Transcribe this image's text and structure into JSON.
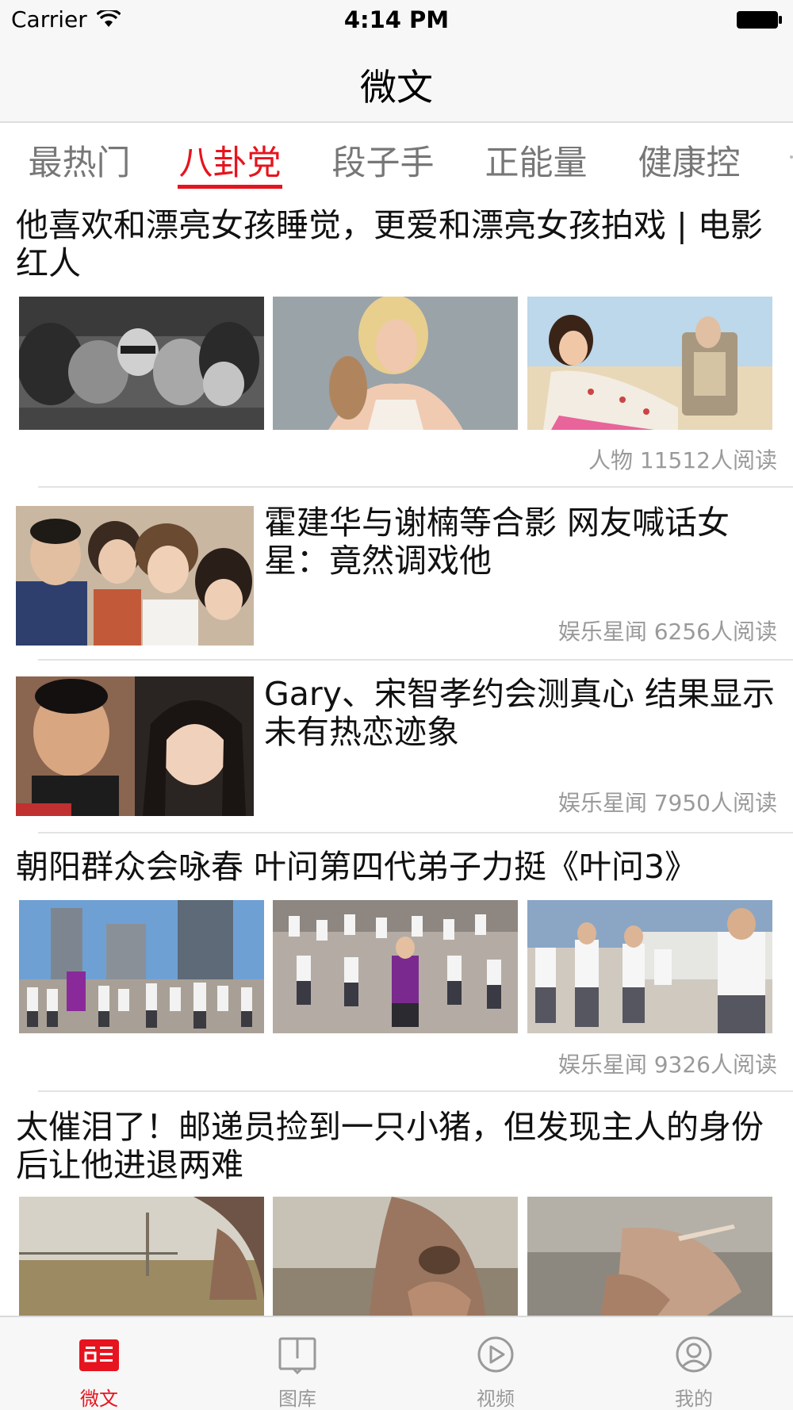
{
  "status_bar": {
    "carrier": "Carrier",
    "time": "4:14 PM"
  },
  "nav": {
    "title": "微文"
  },
  "tabs": [
    {
      "label": "最热门"
    },
    {
      "label": "八卦党"
    },
    {
      "label": "段子手"
    },
    {
      "label": "正能量"
    },
    {
      "label": "健康控"
    }
  ],
  "active_tab": "八卦党",
  "articles": [
    {
      "title_line1": "他喜欢和漂亮女孩睡觉，更爱和漂亮女孩拍戏 | 电影",
      "title_line2": "红人",
      "meta": "人物 11512人阅读",
      "images": [
        "photo-bw-group",
        "photo-blonde-portrait",
        "photo-beach-couple"
      ]
    },
    {
      "title_line1": "霍建华与谢楠等合影 网友喊话女",
      "title_line2": "星：竟然调戏他",
      "meta": "娱乐星闻 6256人阅读",
      "images": [
        "photo-group-selfie"
      ]
    },
    {
      "title_line1": "Gary、宋智孝约会测真心 结果显示",
      "title_line2": "未有热恋迹象",
      "meta": "娱乐星闻 7950人阅读",
      "images": [
        "photo-tv-show"
      ]
    },
    {
      "title_line1": "朝阳群众会咏春 叶问第四代弟子力挺《叶问3》",
      "meta": "娱乐星闻 9326人阅读",
      "images": [
        "photo-crowd-street",
        "photo-crowd-square",
        "photo-crowd-kungfu"
      ]
    },
    {
      "title_line1": "太催泪了！邮递员捡到一只小猪，但发现主人的身份",
      "title_line2": "后让他进退两难",
      "images": [
        "photo-field",
        "photo-man-face",
        "photo-hand-closeup"
      ]
    }
  ],
  "tab_bar": [
    {
      "label": "微文",
      "icon": "news-icon"
    },
    {
      "label": "图库",
      "icon": "book-icon"
    },
    {
      "label": "视频",
      "icon": "play-icon"
    },
    {
      "label": "我的",
      "icon": "profile-icon"
    }
  ],
  "colors": {
    "accent": "#e6141e",
    "meta": "#9a9a9a",
    "inactive_tab": "#777777",
    "bar_bg": "#f7f7f7"
  }
}
